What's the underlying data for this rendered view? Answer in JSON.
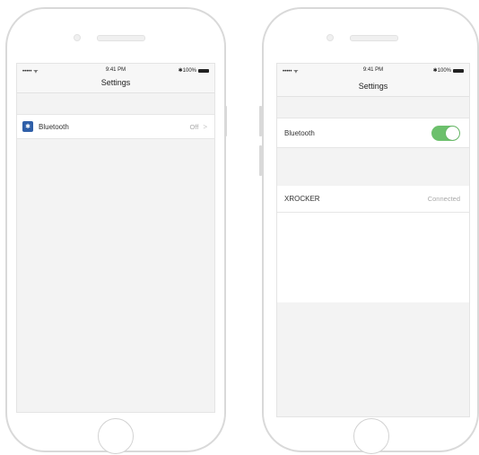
{
  "left_phone": {
    "status": {
      "signal": "••••• ᯤ",
      "time": "9:41 PM",
      "battery": "✱100%"
    },
    "title": "Settings",
    "row": {
      "icon": "bluetooth-icon",
      "label": "Bluetooth",
      "value": "Off",
      "chevron": ">"
    }
  },
  "right_phone": {
    "status": {
      "signal": "••••• ᯤ",
      "time": "9:41 PM",
      "battery": "✱100%"
    },
    "title": "Settings",
    "row": {
      "label": "Bluetooth",
      "toggle_on": true,
      "toggle_color": "#6cc06c"
    },
    "device": {
      "name": "XROCKER",
      "status": "Connected"
    }
  },
  "colors": {
    "bluetooth_badge": "#2f5fa8",
    "toggle_on": "#6cc06c"
  }
}
